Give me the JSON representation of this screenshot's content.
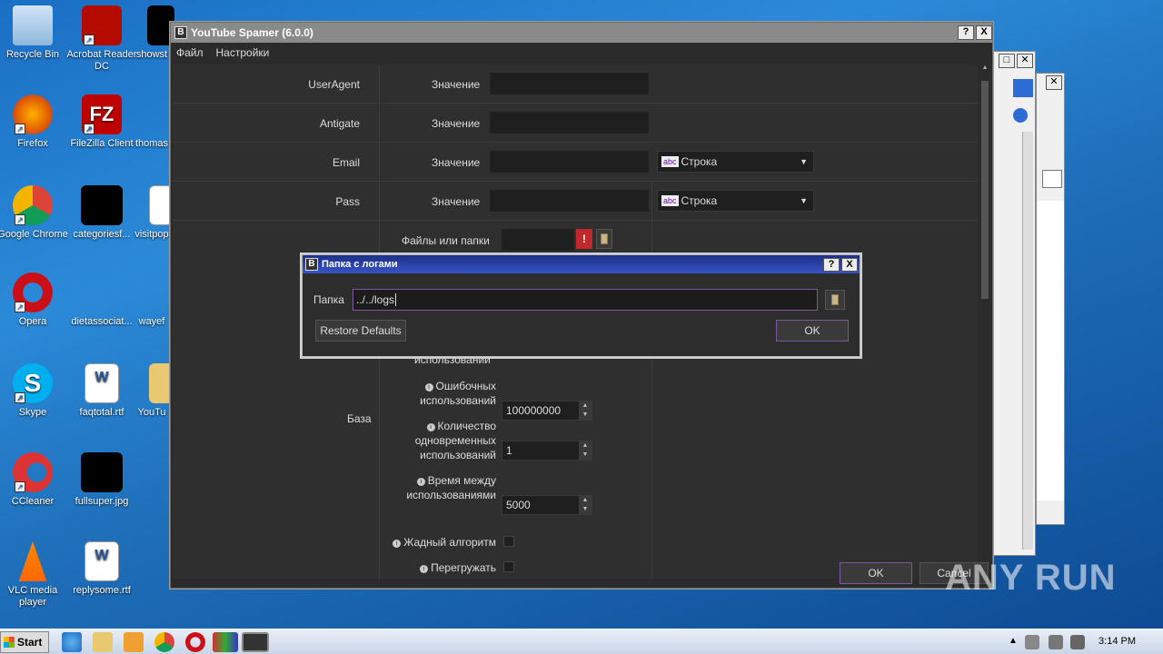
{
  "desktop": {
    "icons": [
      {
        "label": "Recycle Bin"
      },
      {
        "label": "Acrobat Reader DC"
      },
      {
        "label": "showst"
      },
      {
        "label": "Firefox"
      },
      {
        "label": "FileZilla Client"
      },
      {
        "label": "thomas"
      },
      {
        "label": "Google Chrome"
      },
      {
        "label": "categoriesf..."
      },
      {
        "label": "visitpop"
      },
      {
        "label": "Opera"
      },
      {
        "label": "dietassociat..."
      },
      {
        "label": "wayef"
      },
      {
        "label": "Skype"
      },
      {
        "label": "faqtotal.rtf"
      },
      {
        "label": "YouTu"
      },
      {
        "label": "CCleaner"
      },
      {
        "label": "fullsuper.jpg"
      },
      {
        "label": "VLC media player"
      },
      {
        "label": "replysome.rtf"
      }
    ]
  },
  "main_window": {
    "title": "YouTube Spamer (6.0.0)",
    "help_btn": "?",
    "close_btn": "X",
    "menu": [
      "Файл",
      "Настройки"
    ],
    "rows": [
      {
        "label": "UserAgent",
        "value_label": "Значение"
      },
      {
        "label": "Antigate",
        "value_label": "Значение"
      },
      {
        "label": "Email",
        "value_label": "Значение",
        "type": "Строка"
      },
      {
        "label": "Pass",
        "value_label": "Значение",
        "type": "Строка"
      }
    ],
    "files_label": "Файлы или папки",
    "warn_icon": "!",
    "base_label": "База",
    "partial_label": "использований",
    "errors_label": "Ошибочных использований",
    "errors_value": "100000000",
    "concurrent_label": "Количество одновременных использований",
    "concurrent_value": "1",
    "delay_label": "Время между использованиями",
    "delay_value": "5000",
    "greedy_label": "Жадный алгоритм",
    "reload_label": "Перегружать",
    "ok": "OK",
    "cancel": "Cancel"
  },
  "dialog": {
    "title": "Папка с логами",
    "help_btn": "?",
    "close_btn": "X",
    "folder_label": "Папка",
    "folder_value": "../../logs",
    "restore": "Restore Defaults",
    "ok": "OK"
  },
  "taskbar": {
    "start": "Start",
    "time": "3:14 PM"
  },
  "watermark": "ANY RUN"
}
